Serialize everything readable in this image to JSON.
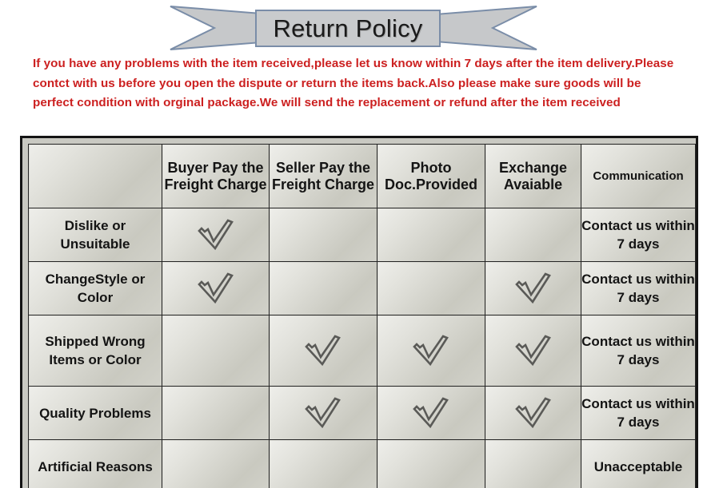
{
  "banner": {
    "title": "Return Policy",
    "ribbon_fill": "#c6c8ca",
    "ribbon_stroke": "#7a8da8",
    "title_box_fill": "#c9cbcd"
  },
  "policy": {
    "color": "#cc2020",
    "text": "If you  have any problems with the item received,please let us know within 7 days after the item delivery.Please contct with us before you open the dispute or return the items back.Also please make sure goods will be perfect condition with orginal package.We will send the replacement or refund after the item received"
  },
  "table": {
    "headers": [
      "",
      "Buyer Pay the Freight Charge",
      "Seller Pay the Freight Charge",
      "Photo Doc.Provided",
      "Exchange Avaiable",
      "Communication"
    ],
    "rows": [
      {
        "reason": "Dislike or Unsuitable",
        "buyer_pay": true,
        "seller_pay": false,
        "photo_doc": false,
        "exchange": false,
        "communication": "Contact us within 7 days"
      },
      {
        "reason": "ChangeStyle or Color",
        "buyer_pay": true,
        "seller_pay": false,
        "photo_doc": false,
        "exchange": true,
        "communication": "Contact us within 7 days"
      },
      {
        "reason": "Shipped Wrong Items or Color",
        "buyer_pay": false,
        "seller_pay": true,
        "photo_doc": true,
        "exchange": true,
        "communication": "Contact us within 7 days"
      },
      {
        "reason": "Quality Problems",
        "buyer_pay": false,
        "seller_pay": true,
        "photo_doc": true,
        "exchange": true,
        "communication": "Contact us within 7 days"
      },
      {
        "reason": "Artificial Reasons",
        "buyer_pay": false,
        "seller_pay": false,
        "photo_doc": false,
        "exchange": false,
        "communication": "Unacceptable"
      }
    ],
    "checkmark_icon": "checkmark-icon",
    "checkmark_color": "#5a5a57"
  }
}
